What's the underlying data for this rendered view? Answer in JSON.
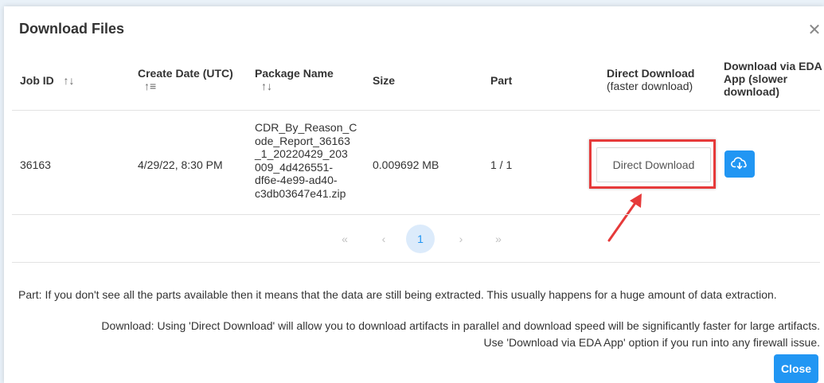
{
  "dialog": {
    "title": "Download Files",
    "close_icon": "close-icon"
  },
  "table": {
    "headers": {
      "job_id": "Job ID",
      "create_date": "Create Date (UTC)",
      "package_name": "Package Name",
      "size": "Size",
      "part": "Part",
      "direct_download_1": "Direct Download",
      "direct_download_2": "(faster download)",
      "eda_1": "Download via EDA",
      "eda_2": "App (slower",
      "eda_3": "download)"
    },
    "row": {
      "job_id": "36163",
      "create_date": "4/29/22, 8:30 PM",
      "package_name_lines": [
        "CDR_By_Reason_C",
        "ode_Report_36163",
        "_1_20220429_203",
        "009_4d426551-",
        "df6e-4e99-ad40-",
        "c3db03647e41.zip"
      ],
      "size": "0.009692 MB",
      "part": "1 / 1",
      "direct_download_label": "Direct Download",
      "eda_icon": "cloud-download-icon"
    }
  },
  "pagination": {
    "first": "«",
    "prev": "‹",
    "current": "1",
    "next": "›",
    "last": "»"
  },
  "notes": {
    "part": "Part: If you don't see all the parts available then it means that the data are still being extracted. This usually happens for a huge amount of data extraction.",
    "download_1": "Download: Using 'Direct Download' will allow you to download artifacts in parallel and download speed will be significantly faster for large artifacts.",
    "download_2": "Use 'Download via EDA App' option if you run into any firewall issue."
  },
  "footer": {
    "close_label": "Close"
  },
  "colors": {
    "accent": "#2196f3",
    "highlight": "#e63a3a"
  }
}
